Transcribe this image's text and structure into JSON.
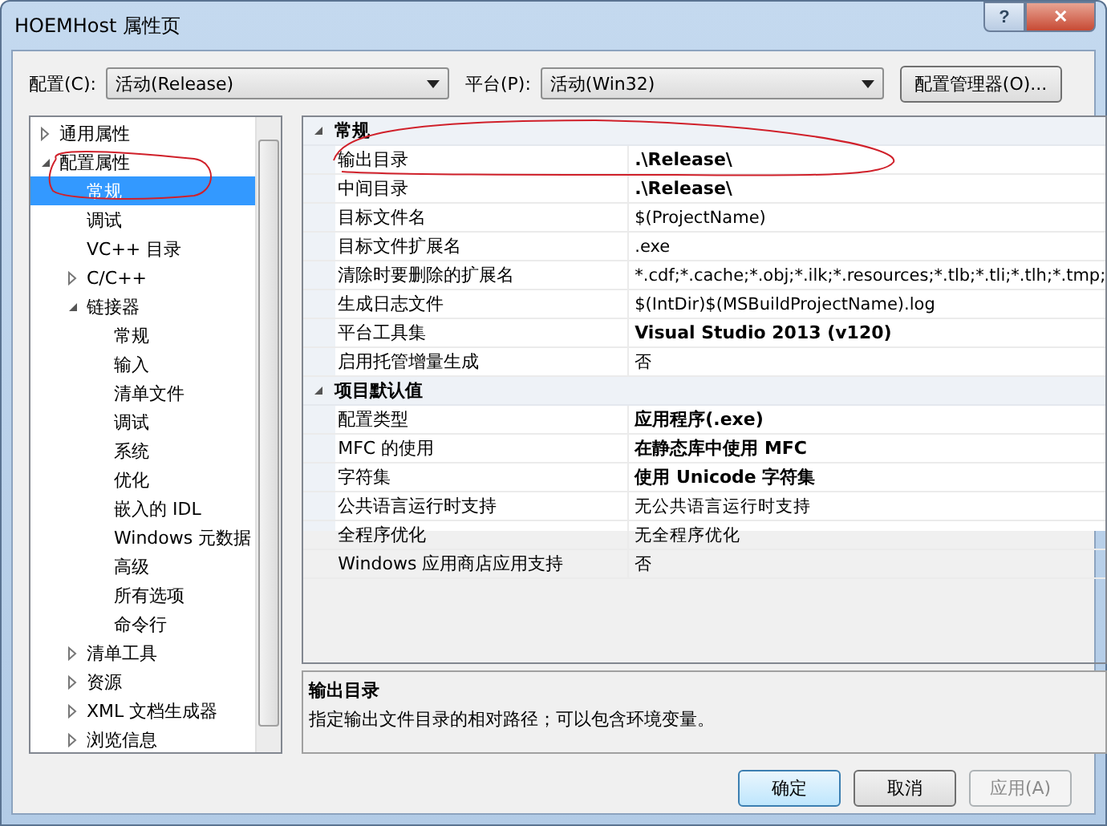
{
  "window": {
    "title": "HOEMHost 属性页",
    "help": "?",
    "close": "✕"
  },
  "toolbar": {
    "config_label": "配置(C):",
    "config_value": "活动(Release)",
    "platform_label": "平台(P):",
    "platform_value": "活动(Win32)",
    "manager_button": "配置管理器(O)..."
  },
  "tree": [
    {
      "label": "通用属性",
      "expanded": false,
      "selected": false
    },
    {
      "label": "配置属性",
      "expanded": true,
      "selected": false,
      "children": [
        {
          "label": "常规",
          "selected": true
        },
        {
          "label": "调试",
          "selected": false
        },
        {
          "label": "VC++ 目录",
          "selected": false
        },
        {
          "label": "C/C++",
          "expanded": false,
          "selected": false
        },
        {
          "label": "链接器",
          "expanded": true,
          "selected": false,
          "children": [
            {
              "label": "常规",
              "selected": false
            },
            {
              "label": "输入",
              "selected": false
            },
            {
              "label": "清单文件",
              "selected": false
            },
            {
              "label": "调试",
              "selected": false
            },
            {
              "label": "系统",
              "selected": false
            },
            {
              "label": "优化",
              "selected": false
            },
            {
              "label": "嵌入的 IDL",
              "selected": false
            },
            {
              "label": "Windows 元数据",
              "selected": false
            },
            {
              "label": "高级",
              "selected": false
            },
            {
              "label": "所有选项",
              "selected": false
            },
            {
              "label": "命令行",
              "selected": false
            }
          ]
        },
        {
          "label": "清单工具",
          "expanded": false,
          "selected": false
        },
        {
          "label": "资源",
          "expanded": false,
          "selected": false
        },
        {
          "label": "XML 文档生成器",
          "expanded": false,
          "selected": false
        },
        {
          "label": "浏览信息",
          "expanded": false,
          "selected": false
        }
      ]
    }
  ],
  "properties": [
    {
      "category": "常规",
      "expanded": true,
      "rows": [
        {
          "name": "输出目录",
          "value": ".\\Release\\",
          "bold": true
        },
        {
          "name": "中间目录",
          "value": ".\\Release\\",
          "bold": true
        },
        {
          "name": "目标文件名",
          "value": "$(ProjectName)",
          "bold": false
        },
        {
          "name": "目标文件扩展名",
          "value": ".exe",
          "bold": false
        },
        {
          "name": "清除时要删除的扩展名",
          "value": "*.cdf;*.cache;*.obj;*.ilk;*.resources;*.tlb;*.tli;*.tlh;*.tmp;",
          "bold": false
        },
        {
          "name": "生成日志文件",
          "value": "$(IntDir)$(MSBuildProjectName).log",
          "bold": false
        },
        {
          "name": "平台工具集",
          "value": "Visual Studio 2013 (v120)",
          "bold": true
        },
        {
          "name": "启用托管增量生成",
          "value": "否",
          "bold": false
        }
      ]
    },
    {
      "category": "项目默认值",
      "expanded": true,
      "rows": [
        {
          "name": "配置类型",
          "value": "应用程序(.exe)",
          "bold": true
        },
        {
          "name": "MFC 的使用",
          "value": "在静态库中使用 MFC",
          "bold": true
        },
        {
          "name": "字符集",
          "value": "使用 Unicode 字符集",
          "bold": true
        },
        {
          "name": "公共语言运行时支持",
          "value": "无公共语言运行时支持",
          "bold": false
        },
        {
          "name": "全程序优化",
          "value": "无全程序优化",
          "bold": false
        },
        {
          "name": "Windows 应用商店应用支持",
          "value": "否",
          "bold": false
        }
      ]
    }
  ],
  "description": {
    "title": "输出目录",
    "text": "指定输出文件目录的相对路径；可以包含环境变量。"
  },
  "buttons": [
    {
      "label": "确定",
      "kind": "default",
      "disabled": false
    },
    {
      "label": "取消",
      "kind": "normal",
      "disabled": false
    },
    {
      "label": "应用(A)",
      "kind": "normal",
      "disabled": true
    }
  ]
}
